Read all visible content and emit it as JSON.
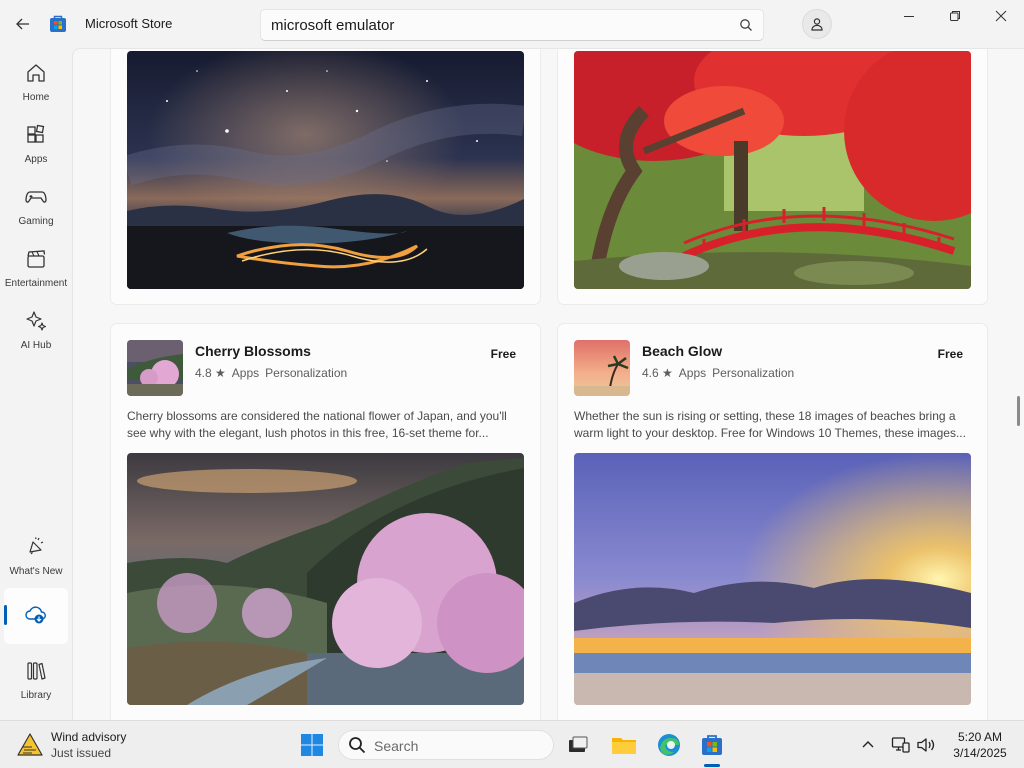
{
  "app": {
    "title": "Microsoft Store",
    "search": {
      "value": "microsoft emulator",
      "icon": "search-icon"
    },
    "account_icon": "person-icon",
    "window_controls": [
      "minimize-icon",
      "maximize-icon",
      "close-icon"
    ]
  },
  "sidebar": {
    "items": [
      {
        "label": "Home",
        "icon": "home-icon"
      },
      {
        "label": "Apps",
        "icon": "apps-icon"
      },
      {
        "label": "Gaming",
        "icon": "gamepad-icon"
      },
      {
        "label": "Entertainment",
        "icon": "clapper-icon"
      },
      {
        "label": "AI Hub",
        "icon": "sparkle-icon"
      }
    ],
    "bottom_items": [
      {
        "label": "What's New",
        "icon": "megaphone-icon"
      },
      {
        "label": "",
        "icon": "downloads-icon",
        "active": true
      },
      {
        "label": "Library",
        "icon": "library-icon"
      }
    ]
  },
  "cards": [
    {
      "name": "Cherry Blossoms",
      "price": "Free",
      "rating": "4.8 ★",
      "type": "Apps",
      "category": "Personalization",
      "description": "Cherry blossoms are considered the national flower of Japan, and you'll see why with the elegant, lush photos in this free, 16-set theme for..."
    },
    {
      "name": "Beach Glow",
      "price": "Free",
      "rating": "4.6 ★",
      "type": "Apps",
      "category": "Personalization",
      "description": "Whether the sun is rising or setting, these 18 images of beaches bring a warm light to your desktop. Free for Windows 10 Themes, these images..."
    }
  ],
  "taskbar": {
    "weather": {
      "title": "Wind advisory",
      "subtitle": "Just issued",
      "icon": "warning-icon"
    },
    "search_label": "Search",
    "apps": [
      "windows-start-icon",
      "task-view-icon",
      "file-explorer-icon",
      "edge-icon",
      "store-icon"
    ],
    "tray": [
      "chevron-up-icon",
      "network-icon",
      "volume-icon"
    ],
    "time": "5:20 AM",
    "date": "3/14/2025"
  },
  "colors": {
    "accent": "#005fb8",
    "bridge_red": "#d8202a",
    "blossom": "#e3a7d4"
  }
}
